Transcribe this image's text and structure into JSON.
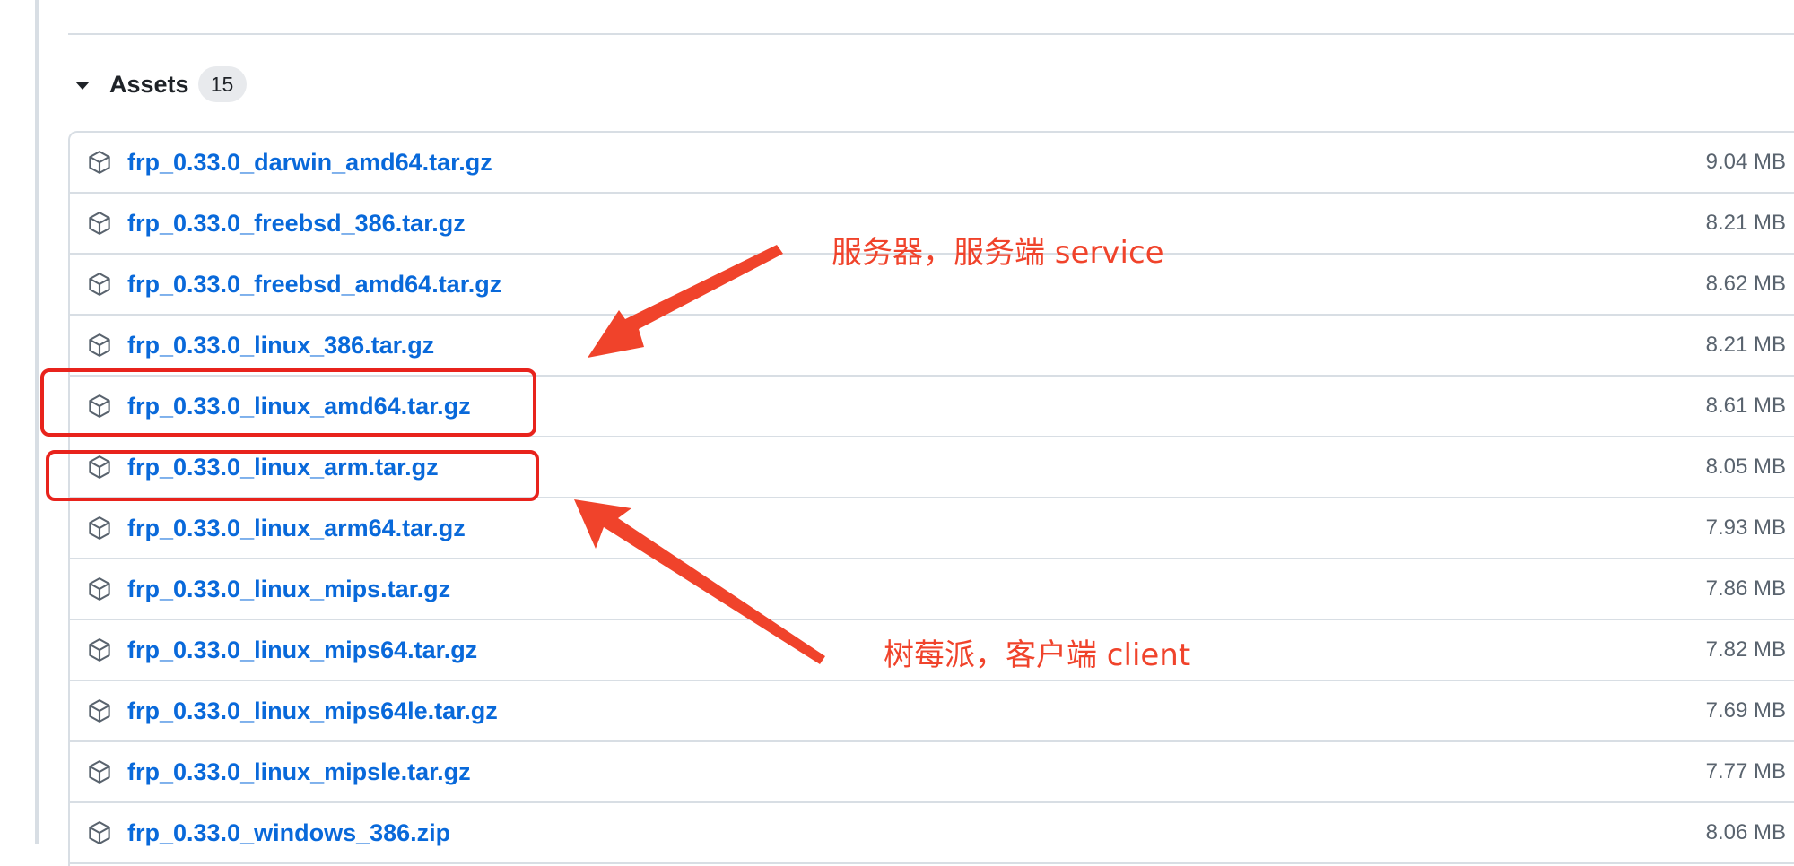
{
  "section": {
    "title": "Assets",
    "count": "15"
  },
  "assets": [
    {
      "name": "frp_0.33.0_darwin_amd64.tar.gz",
      "size": "9.04 MB"
    },
    {
      "name": "frp_0.33.0_freebsd_386.tar.gz",
      "size": "8.21 MB"
    },
    {
      "name": "frp_0.33.0_freebsd_amd64.tar.gz",
      "size": "8.62 MB"
    },
    {
      "name": "frp_0.33.0_linux_386.tar.gz",
      "size": "8.21 MB"
    },
    {
      "name": "frp_0.33.0_linux_amd64.tar.gz",
      "size": "8.61 MB"
    },
    {
      "name": "frp_0.33.0_linux_arm.tar.gz",
      "size": "8.05 MB"
    },
    {
      "name": "frp_0.33.0_linux_arm64.tar.gz",
      "size": "7.93 MB"
    },
    {
      "name": "frp_0.33.0_linux_mips.tar.gz",
      "size": "7.86 MB"
    },
    {
      "name": "frp_0.33.0_linux_mips64.tar.gz",
      "size": "7.82 MB"
    },
    {
      "name": "frp_0.33.0_linux_mips64le.tar.gz",
      "size": "7.69 MB"
    },
    {
      "name": "frp_0.33.0_linux_mipsle.tar.gz",
      "size": "7.77 MB"
    },
    {
      "name": "frp_0.33.0_windows_386.zip",
      "size": "8.06 MB"
    }
  ],
  "annotations": {
    "server_note": "服务器，服务端 service",
    "client_note": "树莓派，客户端 client"
  },
  "colors": {
    "link": "#0969da",
    "annotation": "#f0432b",
    "highlight_border": "#e8231c"
  },
  "icons": {
    "toggle": "caret-down-icon",
    "asset": "package-icon"
  }
}
